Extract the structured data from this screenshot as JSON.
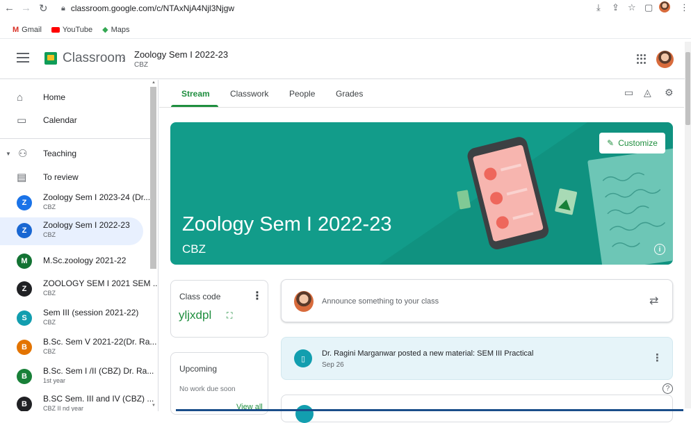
{
  "browser": {
    "url": "classroom.google.com/c/NTAxNjA4Njl3Njgw",
    "bookmarks": [
      "Gmail",
      "YouTube",
      "Maps"
    ]
  },
  "header": {
    "app_title": "Classroom",
    "class_title": "Zoology Sem I 2022-23",
    "class_section": "CBZ"
  },
  "sidebar": {
    "nav": [
      {
        "label": "Home",
        "icon": "home-icon"
      },
      {
        "label": "Calendar",
        "icon": "calendar-icon"
      },
      {
        "label": "Teaching",
        "icon": "people-icon"
      },
      {
        "label": "To review",
        "icon": "review-icon"
      }
    ],
    "classes": [
      {
        "letter": "Z",
        "name": "Zoology Sem I 2023-24 (Dr...",
        "sub": "CBZ",
        "color": "#1a73e8",
        "active": false
      },
      {
        "letter": "Z",
        "name": "Zoology Sem I 2022-23",
        "sub": "CBZ",
        "color": "#1967d2",
        "active": true
      },
      {
        "letter": "M",
        "name": "M.Sc.zoology 2021-22",
        "sub": "",
        "color": "#137333",
        "active": false
      },
      {
        "letter": "Z",
        "name": "ZOOLOGY SEM I 2021 SEM ...",
        "sub": "CBZ",
        "color": "#202124",
        "active": false
      },
      {
        "letter": "S",
        "name": "Sem III (session 2021-22)",
        "sub": "CBZ",
        "color": "#129eaf",
        "active": false
      },
      {
        "letter": "B",
        "name": "B.Sc. Sem V 2021-22(Dr. Ra...",
        "sub": "CBZ",
        "color": "#e37400",
        "active": false
      },
      {
        "letter": "B",
        "name": "B.Sc. Sem I /II (CBZ) Dr. Ra...",
        "sub": "1st year",
        "color": "#188038",
        "active": false
      },
      {
        "letter": "B",
        "name": "B.SC Sem. III and IV (CBZ) ...",
        "sub": "CBZ II nd year",
        "color": "#202124",
        "active": false
      }
    ]
  },
  "tabs": [
    "Stream",
    "Classwork",
    "People",
    "Grades"
  ],
  "banner": {
    "title": "Zoology Sem I 2022-23",
    "subtitle": "CBZ",
    "customize_label": "Customize",
    "color": "#129c8a"
  },
  "class_code": {
    "label": "Class code",
    "value": "yljxdpl"
  },
  "upcoming": {
    "title": "Upcoming",
    "empty_text": "No work due soon",
    "view_all": "View all"
  },
  "announce": {
    "placeholder": "Announce something to your class"
  },
  "post": {
    "title": "Dr. Ragini Marganwar posted a new material: SEM III Practical",
    "date": "Sep 26"
  },
  "colors": {
    "accent": "#1e8e3e",
    "banner": "#129c8a"
  }
}
